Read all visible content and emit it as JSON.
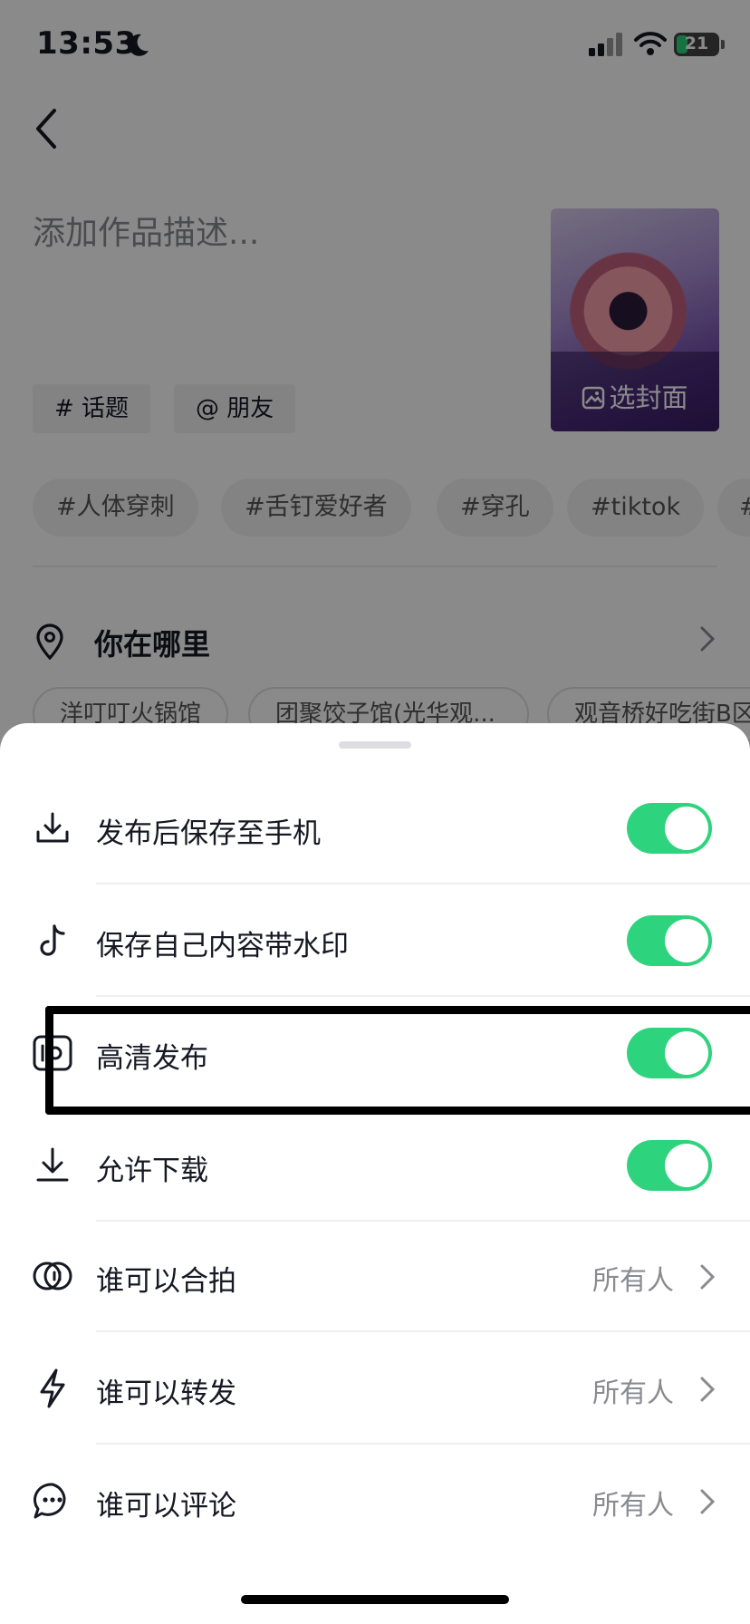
{
  "status_bar": {
    "time": "13:53",
    "battery": "21"
  },
  "compose": {
    "description_placeholder": "添加作品描述...",
    "cover_label": "选封面",
    "topic_button": "# 话题",
    "mention_button": "@ 朋友",
    "hashtags": [
      "#人体穿刺",
      "#舌钉爱好者",
      "#穿孔",
      "#tiktok",
      "#"
    ]
  },
  "location": {
    "label": "你在哪里",
    "suggestions": [
      "洋叮叮火锅馆",
      "团聚饺子馆(光华观...",
      "观音桥好吃街B区"
    ]
  },
  "settings_sheet": {
    "toggles": [
      {
        "label": "发布后保存至手机",
        "icon": "download-tray-icon",
        "on": true
      },
      {
        "label": "保存自己内容带水印",
        "icon": "tiktok-note-icon",
        "on": true
      },
      {
        "label": "高清发布",
        "icon": "hd-icon",
        "on": true
      },
      {
        "label": "允许下载",
        "icon": "download-icon",
        "on": true
      }
    ],
    "options": [
      {
        "label": "谁可以合拍",
        "value": "所有人",
        "icon": "duet-icon"
      },
      {
        "label": "谁可以转发",
        "value": "所有人",
        "icon": "lightning-icon"
      },
      {
        "label": "谁可以评论",
        "value": "所有人",
        "icon": "comment-icon"
      }
    ]
  },
  "colors": {
    "toggle_on": "#2ed47d",
    "highlight_box": "#000000"
  }
}
